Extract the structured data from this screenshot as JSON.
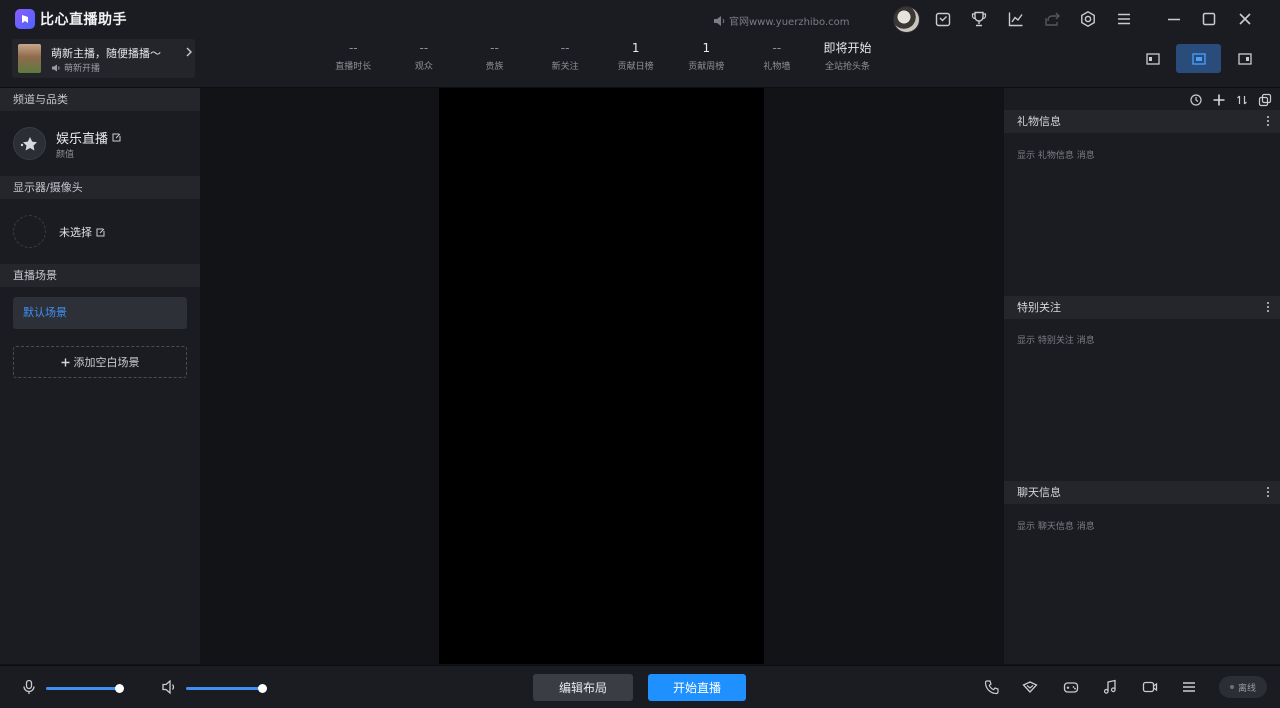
{
  "app": {
    "title": "比心直播助手",
    "official_site": "官网www.yuerzhibo.com"
  },
  "host": {
    "name": "萌新主播，随便播播～",
    "subtitle": "萌新开播"
  },
  "stats": [
    {
      "value": "--",
      "label": "直播时长"
    },
    {
      "value": "--",
      "label": "观众"
    },
    {
      "value": "--",
      "label": "贵族"
    },
    {
      "value": "--",
      "label": "新关注"
    },
    {
      "value": "1",
      "label": "贡献日榜"
    },
    {
      "value": "1",
      "label": "贡献周榜"
    },
    {
      "value": "--",
      "label": "礼物墙"
    },
    {
      "value": "即将开始",
      "label": "全站抢头条"
    }
  ],
  "left_panel": {
    "channel_section": "频道与品类",
    "channel_name": "娱乐直播",
    "channel_category": "颜值",
    "camera_section": "显示器/摄像头",
    "camera_value": "未选择",
    "scene_section": "直播场景",
    "scenes": [
      "默认场景"
    ],
    "add_scene_label": "添加空白场景"
  },
  "right_panel": {
    "panels": [
      {
        "title": "礼物信息",
        "hint": "显示 礼物信息 消息"
      },
      {
        "title": "特别关注",
        "hint": "显示 特别关注 消息"
      },
      {
        "title": "聊天信息",
        "hint": "显示 聊天信息 消息"
      }
    ]
  },
  "bottom": {
    "mic_volume": 0.93,
    "speaker_volume": 0.95,
    "edit_layout_label": "编辑布局",
    "start_live_label": "开始直播",
    "status_label": "离线"
  },
  "colors": {
    "accent": "#1e90ff",
    "selected_text": "#3f8ff5",
    "background": "#1b1c21"
  }
}
